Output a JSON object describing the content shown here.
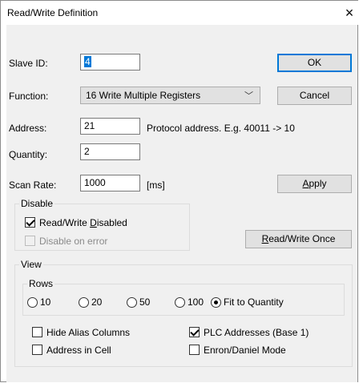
{
  "window": {
    "title": "Read/Write Definition",
    "close_glyph": "×"
  },
  "fields": {
    "slave_id": {
      "label": "Slave ID:",
      "value": "4"
    },
    "function": {
      "label": "Function:",
      "value": "16 Write Multiple Registers"
    },
    "address": {
      "label": "Address:",
      "value": "21",
      "hint": "Protocol address. E.g. 40011 -> 10"
    },
    "quantity": {
      "label": "Quantity:",
      "value": "2"
    },
    "scan_rate": {
      "label": "Scan Rate:",
      "value": "1000",
      "unit": "[ms]"
    }
  },
  "buttons": {
    "ok": "OK",
    "cancel": "Cancel",
    "apply_pre": "",
    "apply_key": "A",
    "apply_post": "pply",
    "rw_once_pre": "",
    "rw_once_key": "R",
    "rw_once_post": "ead/Write Once"
  },
  "disable_group": {
    "legend": "Disable",
    "rw_disabled_pre": "Read/Write ",
    "rw_disabled_key": "D",
    "rw_disabled_post": "isabled",
    "rw_disabled_checked": true,
    "disable_on_error": "Disable on error",
    "disable_on_error_checked": false
  },
  "view_group": {
    "legend": "View",
    "rows": {
      "legend": "Rows",
      "options": [
        "10",
        "20",
        "50",
        "100",
        "Fit to Quantity"
      ],
      "selected": "Fit to Quantity"
    },
    "hide_alias": {
      "label": "Hide Alias Columns",
      "checked": false
    },
    "plc_addresses": {
      "label": "PLC Addresses (Base 1)",
      "checked": true
    },
    "address_in_cell": {
      "label": "Address in Cell",
      "checked": false
    },
    "enron_mode": {
      "label": "Enron/Daniel Mode",
      "checked": false
    }
  }
}
